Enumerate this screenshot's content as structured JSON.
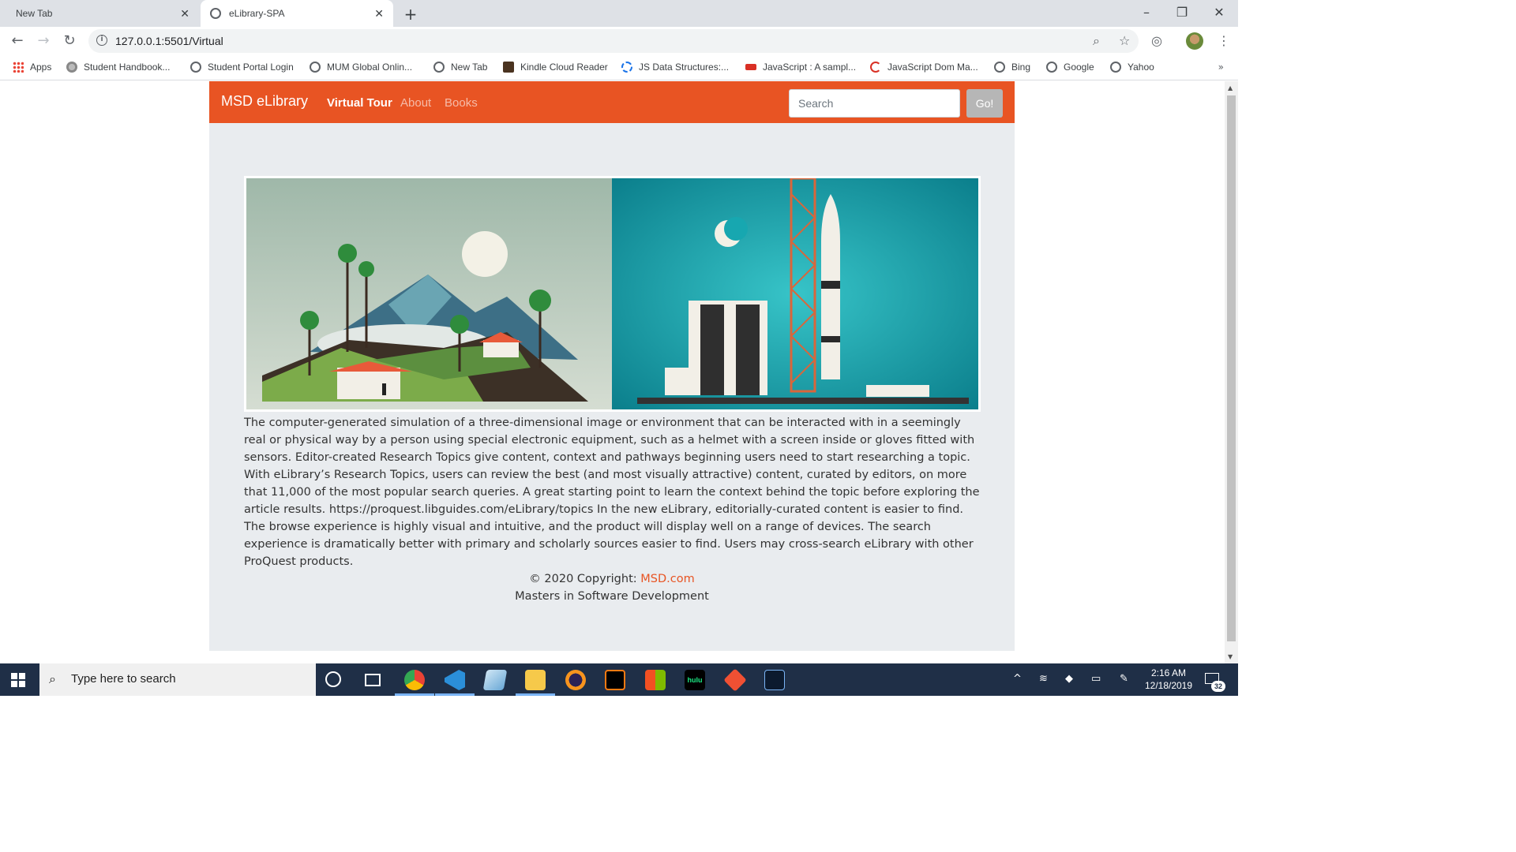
{
  "browser": {
    "tabs": [
      {
        "title": "New Tab",
        "active": false
      },
      {
        "title": "eLibrary-SPA",
        "active": true
      }
    ],
    "url": "127.0.0.1:5501/Virtual",
    "bookmarks": [
      {
        "label": "Apps",
        "icon": "apps-grid-icon"
      },
      {
        "label": "Student Handbook...",
        "icon": "handbook-icon"
      },
      {
        "label": "Student Portal Login",
        "icon": "globe-icon"
      },
      {
        "label": "MUM Global Onlin...",
        "icon": "globe-icon"
      },
      {
        "label": "New Tab",
        "icon": "globe-icon"
      },
      {
        "label": "Kindle Cloud Reader",
        "icon": "kindle-icon"
      },
      {
        "label": "JS Data Structures:...",
        "icon": "js-data-icon"
      },
      {
        "label": "JavaScript : A sampl...",
        "icon": "js-sample-icon"
      },
      {
        "label": "JavaScript Dom Ma...",
        "icon": "js-dom-icon"
      },
      {
        "label": "Bing",
        "icon": "globe-icon"
      },
      {
        "label": "Google",
        "icon": "globe-icon"
      },
      {
        "label": "Yahoo",
        "icon": "globe-icon"
      }
    ],
    "more_label": "»"
  },
  "site": {
    "brand": "MSD eLibrary",
    "nav": [
      {
        "label": "Virtual Tour",
        "active": true
      },
      {
        "label": "About",
        "active": false
      },
      {
        "label": "Books",
        "active": false
      }
    ],
    "search_placeholder": "Search",
    "go_label": "Go!",
    "accent_color": "#e85423",
    "article": "The computer-generated simulation of a three-dimensional image or environment that can be interacted with in a seemingly real or physical way by a person using special electronic equipment, such as a helmet with a screen inside or gloves fitted with sensors. Editor-created Research Topics give content, context and pathways beginning users need to start researching a topic. With eLibrary’s Research Topics, users can review the best (and most visually attractive) content, curated by editors, on more that 11,000 of the most popular search queries. A great starting point to learn the context behind the topic before exploring the article results. https://proquest.libguides.com/eLibrary/topics In the new eLibrary, editorially-curated content is easier to find. The browse experience is highly visual and intuitive, and the product will display well on a range of devices. The search experience is dramatically better with primary and scholarly sources easier to find. Users may cross-search eLibrary with other ProQuest products.",
    "footer": {
      "copyright_prefix": "© 2020 Copyright: ",
      "copyright_link": "MSD.com",
      "tagline": "Masters in Software Development"
    }
  },
  "taskbar": {
    "search_placeholder": "Type here to search",
    "time": "2:16 AM",
    "date": "12/18/2019",
    "notification_count": "32",
    "apps": [
      "cortana-icon",
      "task-view-icon",
      "chrome-icon",
      "vscode-icon",
      "notepad-icon",
      "file-explorer-icon",
      "eclipse-icon",
      "intellij-icon",
      "store-icon",
      "hulu-icon",
      "git-icon",
      "kite-icon"
    ],
    "hulu_label": "hulu"
  }
}
